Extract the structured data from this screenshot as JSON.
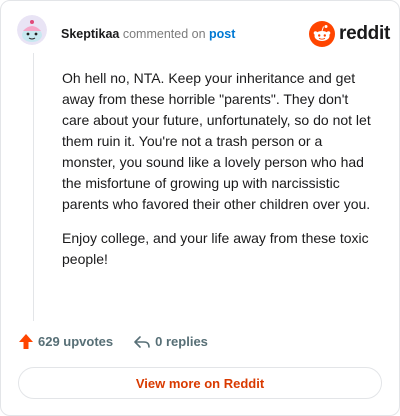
{
  "comment": {
    "username": "Skeptikaa",
    "action_text": "commented on",
    "post_link": "post",
    "paragraphs": [
      "Oh hell no, NTA. Keep your inheritance and get away from these horrible \"parents\". They don't care about your future, unfortunately, so do not let them ruin it. You're not a trash person or a monster, you sound like a lovely person who had the misfortune of growing up with narcissistic parents who favored their other children over you.",
      "Enjoy college, and your life away from these toxic people!"
    ],
    "upvotes_label": "629 upvotes",
    "replies_label": "0 replies"
  },
  "branding": {
    "logo_text": "reddit",
    "brand_color": "#ff4500"
  },
  "footer": {
    "view_more_label": "View more on Reddit"
  },
  "icons": {
    "avatar": "snoo-avatar-icon",
    "logo": "reddit-logo-icon",
    "upvote": "upvote-arrow-icon",
    "reply": "reply-arrow-icon"
  }
}
